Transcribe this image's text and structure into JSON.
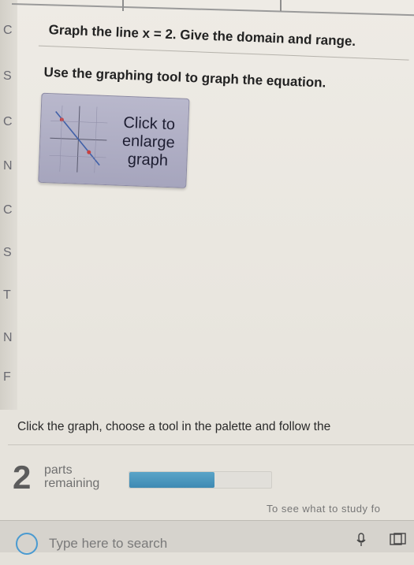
{
  "question": {
    "title": "Graph the line x = 2. Give the domain and range.",
    "instruction": "Use the graphing tool to graph the equation."
  },
  "graph_button": {
    "line1": "Click to",
    "line2": "enlarge",
    "line3": "graph"
  },
  "hint": "Click the graph, choose a tool in the palette and follow the",
  "progress": {
    "parts_count": "2",
    "parts_label_1": "parts",
    "parts_label_2": "remaining",
    "fraction_complete": 0.6,
    "fill_color": "#4a94bd"
  },
  "cutoff_text": "To see what to study fo",
  "taskbar": {
    "search_placeholder": "Type here to search"
  },
  "sidebar_letters": [
    "C",
    "S",
    "C",
    "N",
    "C",
    "S",
    "T",
    "N",
    "F"
  ],
  "icons": {
    "graph_thumbnail": "graph-thumbnail-icon",
    "search": "search-icon",
    "microphone": "microphone-icon",
    "task_view": "task-view-icon"
  }
}
